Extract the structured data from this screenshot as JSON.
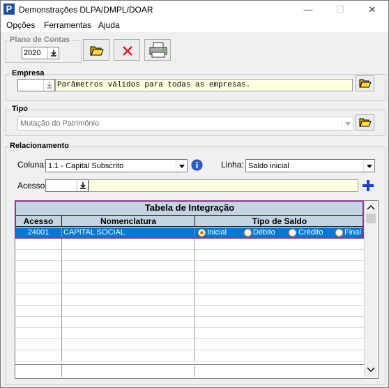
{
  "window": {
    "title": "Demonstrações DLPA/DMPL/DOAR",
    "app_icon_letter": "P",
    "minimize": "—",
    "maximize": "☐",
    "close": "✕"
  },
  "menu": [
    "Opções",
    "Ferramentas",
    "Ajuda"
  ],
  "plano_contas": {
    "label": "Plano de Contas",
    "year": "2020"
  },
  "empresa": {
    "label": "Empresa",
    "code": "",
    "description": "Parâmetros válidos para todas as empresas."
  },
  "tipo": {
    "label": "Tipo",
    "value": "Mutação do Patrimônio"
  },
  "relacionamento": {
    "label": "Relacionamento",
    "coluna_label": "Coluna:",
    "coluna_value": "1.1 - Capital Subscrito",
    "linha_label": "Linha:",
    "linha_value": "Saldo inicial",
    "acesso_label": "Acesso:",
    "acesso_value": ""
  },
  "table": {
    "title": "Tabela de Integração",
    "columns": [
      "Acesso",
      "Nomenclatura",
      "Tipo de Saldo"
    ],
    "rows": [
      {
        "acesso": "24001",
        "nomenclatura": "CAPITAL SOCIAL",
        "tipo_saldo": "Inicial"
      }
    ],
    "saldo_options": [
      "Inicial",
      "Débito",
      "Crédito",
      "Final"
    ]
  },
  "colors": {
    "accent": "#0078d7",
    "header_band": "#c5d4e2",
    "highlight_border": "#8b3a8b",
    "yellow_field": "#ffffe1"
  }
}
